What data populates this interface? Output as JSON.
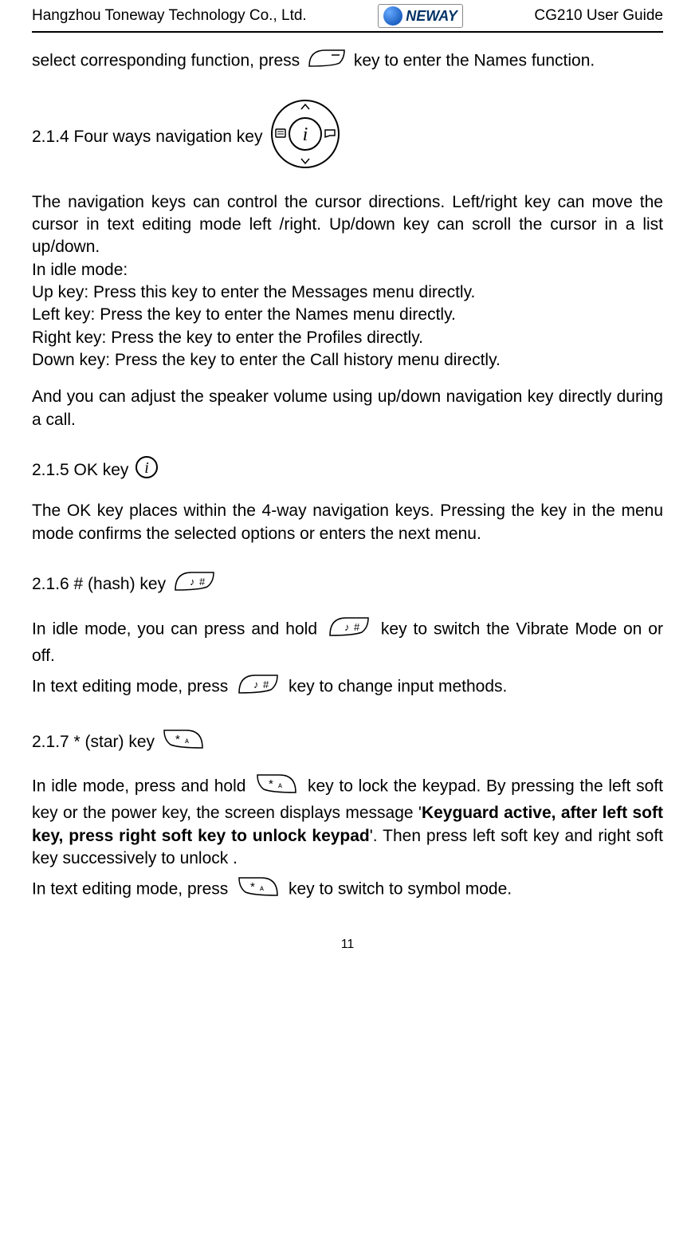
{
  "header": {
    "company": "Hangzhou Toneway Technology Co., Ltd.",
    "logo_text": "NEWAY",
    "guide": "CG210 User Guide"
  },
  "content": {
    "line1_a": "select corresponding function, press ",
    "line1_b": " key to enter the Names function.",
    "sec_214": "2.1.4 Four ways navigation key ",
    "nav_para1": "The navigation keys can control the cursor directions. Left/right key can move the cursor in text editing mode left /right. Up/down key can scroll the cursor in a list up/down.",
    "nav_idle": "In idle mode:",
    "nav_up": "Up key: Press this key to enter the Messages menu directly.",
    "nav_left": "Left key: Press the key to enter the Names menu directly.",
    "nav_right": "Right key: Press the key to enter the Profiles directly.",
    "nav_down": "Down key: Press the key to enter the Call history menu directly.",
    "nav_vol": "And you can adjust the speaker volume using up/down navigation key directly during a call.",
    "sec_215": "2.1.5 OK key ",
    "ok_para": "The OK key places within the 4-way navigation keys. Pressing the key in the menu mode confirms the selected options or enters the next menu.",
    "sec_216": "2.1.6 # (hash) key ",
    "hash_idle_a": "In idle mode, you can press and hold ",
    "hash_idle_b": " key to switch the Vibrate Mode on or off.",
    "hash_edit_a": "In text editing mode, press ",
    "hash_edit_b": " key to change input methods.",
    "sec_217": "2.1.7 * (star) key ",
    "star_idle_a": "In idle mode, press and hold ",
    "star_idle_b": " key to lock the keypad. By pressing the left soft key or the power key, the screen displays message '",
    "star_bold": "Keyguard active, after left soft key, press right soft key to unlock keypad",
    "star_idle_c": "'. Then press left soft key and right soft key successively to unlock .",
    "star_edit_a": "In text editing mode, press ",
    "star_edit_b": " key to switch to symbol mode."
  },
  "page_number": "11"
}
